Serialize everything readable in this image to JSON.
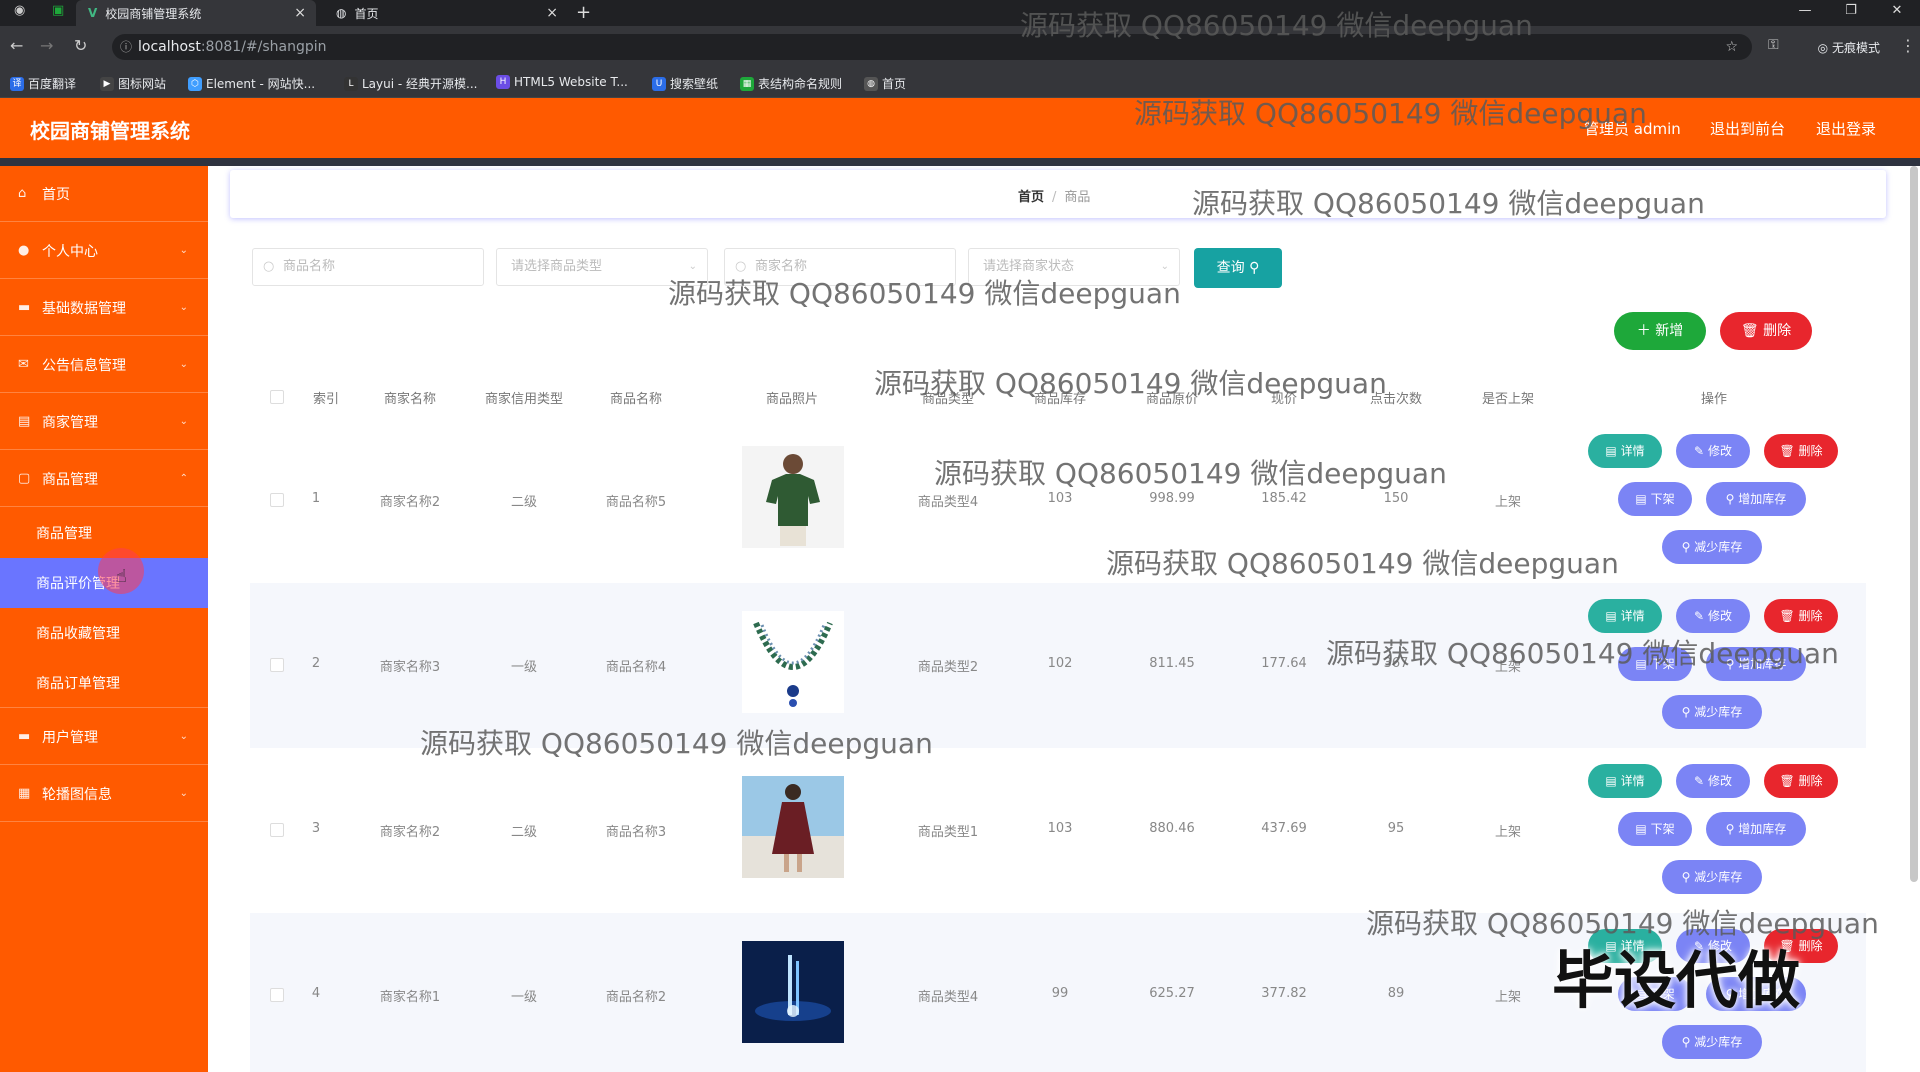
{
  "browser": {
    "tabs": [
      {
        "label": "校园商铺管理系统",
        "close": "×"
      },
      {
        "label": "首页",
        "close": "×"
      }
    ],
    "new_tab": "+",
    "window_controls": [
      "—",
      "❐",
      "✕"
    ],
    "url_host": "localhost",
    "url_path": ":8081/#/shangpin",
    "incognito_label": "无痕模式",
    "bookmarks": [
      "百度翻译",
      "图标网站",
      "Element - 网站快...",
      "Layui - 经典开源模...",
      "HTML5 Website T...",
      "搜索壁纸",
      "表结构命名规则",
      "首页"
    ]
  },
  "header": {
    "title": "校园商铺管理系统",
    "admin_label": "管理员 admin",
    "back_label": "退出到前台",
    "logout_label": "退出登录"
  },
  "sidebar": {
    "items": [
      {
        "label": "首页",
        "icon": "home-icon"
      },
      {
        "label": "个人中心",
        "icon": "user-icon"
      },
      {
        "label": "基础数据管理",
        "icon": "data-icon"
      },
      {
        "label": "公告信息管理",
        "icon": "notice-icon"
      },
      {
        "label": "商家管理",
        "icon": "shop-icon"
      },
      {
        "label": "商品管理",
        "icon": "goods-icon"
      },
      {
        "label": "用户管理",
        "icon": "users-icon"
      },
      {
        "label": "轮播图信息",
        "icon": "carousel-icon"
      }
    ],
    "sub_items": [
      {
        "label": "商品管理"
      },
      {
        "label": "商品评价管理"
      },
      {
        "label": "商品收藏管理"
      },
      {
        "label": "商品订单管理"
      }
    ]
  },
  "breadcrumb": {
    "home": "首页",
    "sep": "/",
    "current": "商品"
  },
  "search": {
    "name_placeholder": "商品名称",
    "type_placeholder": "请选择商品类型",
    "shop_placeholder": "商家名称",
    "status_placeholder": "请选择商家状态",
    "query_label": "查询"
  },
  "toolbar": {
    "add_label": "新增",
    "delete_label": "删除"
  },
  "table": {
    "headers": [
      "索引",
      "商家名称",
      "商家信用类型",
      "商品名称",
      "商品照片",
      "商品类型",
      "商品库存",
      "商品原价",
      "现价",
      "点击次数",
      "是否上架",
      "操作"
    ],
    "rows": [
      {
        "index": "1",
        "shop": "商家名称2",
        "credit": "二级",
        "name": "商品名称5",
        "type": "商品类型4",
        "stock": "103",
        "price": "998.99",
        "now": "185.42",
        "clicks": "150",
        "status": "上架"
      },
      {
        "index": "2",
        "shop": "商家名称3",
        "credit": "一级",
        "name": "商品名称4",
        "type": "商品类型2",
        "stock": "102",
        "price": "811.45",
        "now": "177.64",
        "clicks": "367",
        "status": "上架"
      },
      {
        "index": "3",
        "shop": "商家名称2",
        "credit": "二级",
        "name": "商品名称3",
        "type": "商品类型1",
        "stock": "103",
        "price": "880.46",
        "now": "437.69",
        "clicks": "95",
        "status": "上架"
      },
      {
        "index": "4",
        "shop": "商家名称1",
        "credit": "一级",
        "name": "商品名称2",
        "type": "商品类型4",
        "stock": "99",
        "price": "625.27",
        "now": "377.82",
        "clicks": "89",
        "status": "上架"
      }
    ],
    "actions": {
      "detail": "详情",
      "edit": "修改",
      "delete": "删除",
      "off_shelf": "下架",
      "add_stock": "增加库存",
      "reduce_stock": "减少库存"
    }
  },
  "watermark": "源码获取 QQ86050149 微信deepguan",
  "stamp": "毕设代做"
}
